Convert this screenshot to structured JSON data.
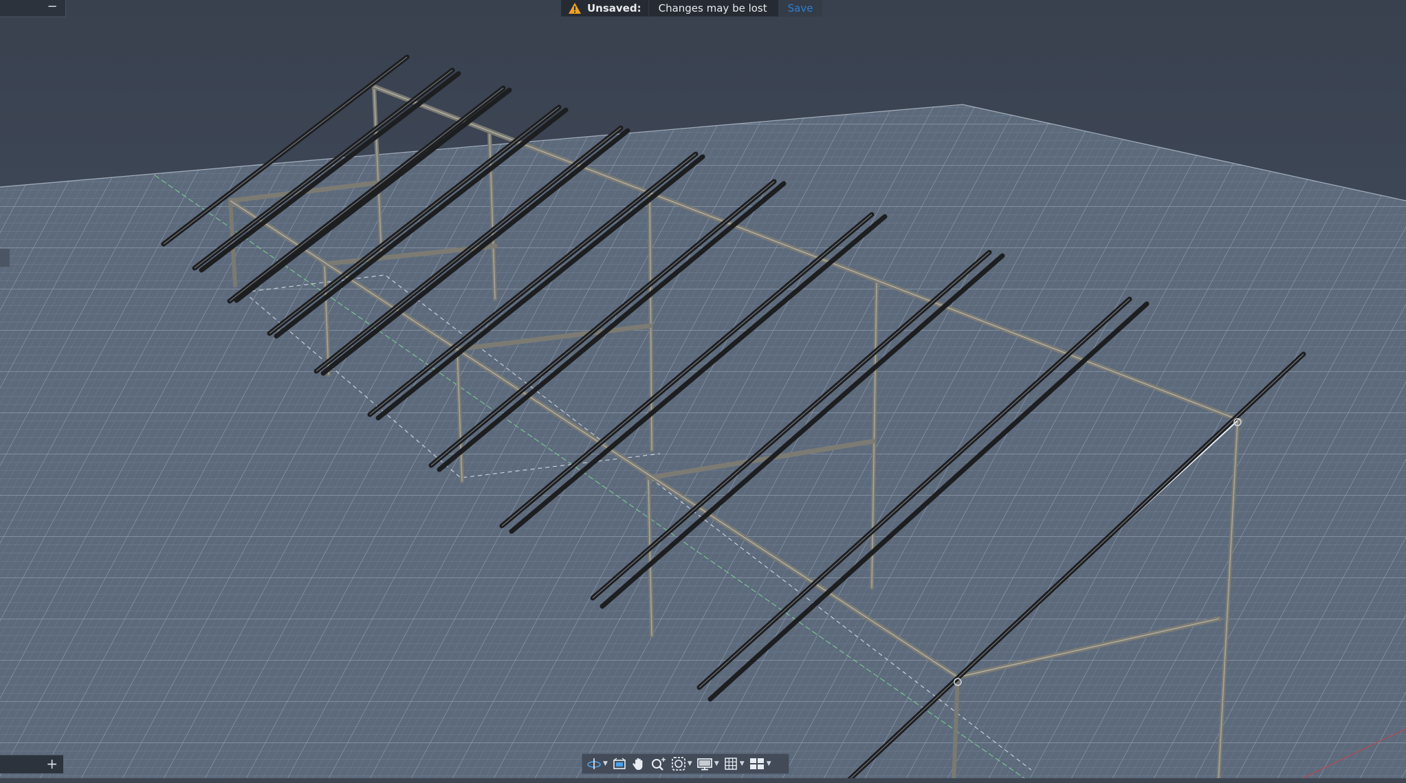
{
  "notification": {
    "label": "Unsaved:",
    "message": "Changes may be lost",
    "save_label": "Save"
  },
  "panels": {
    "collapse_symbol": "−",
    "add_symbol": "+"
  },
  "icons": {
    "warning": "warning-icon",
    "orbit": "orbit-icon",
    "view": "view-cube-icon",
    "pan": "pan-hand-icon",
    "zoom": "zoom-icon",
    "window_zoom": "zoom-window-icon",
    "display": "display-settings-icon",
    "grid": "grid-icon",
    "viewports": "viewports-icon"
  },
  "colors": {
    "background": "#3a4352",
    "grid": "#8fa0b3",
    "accent": "#2d7fd0",
    "warning": "#f0a01e",
    "frame": "#7a7a72",
    "rail": "#1d1e20"
  }
}
